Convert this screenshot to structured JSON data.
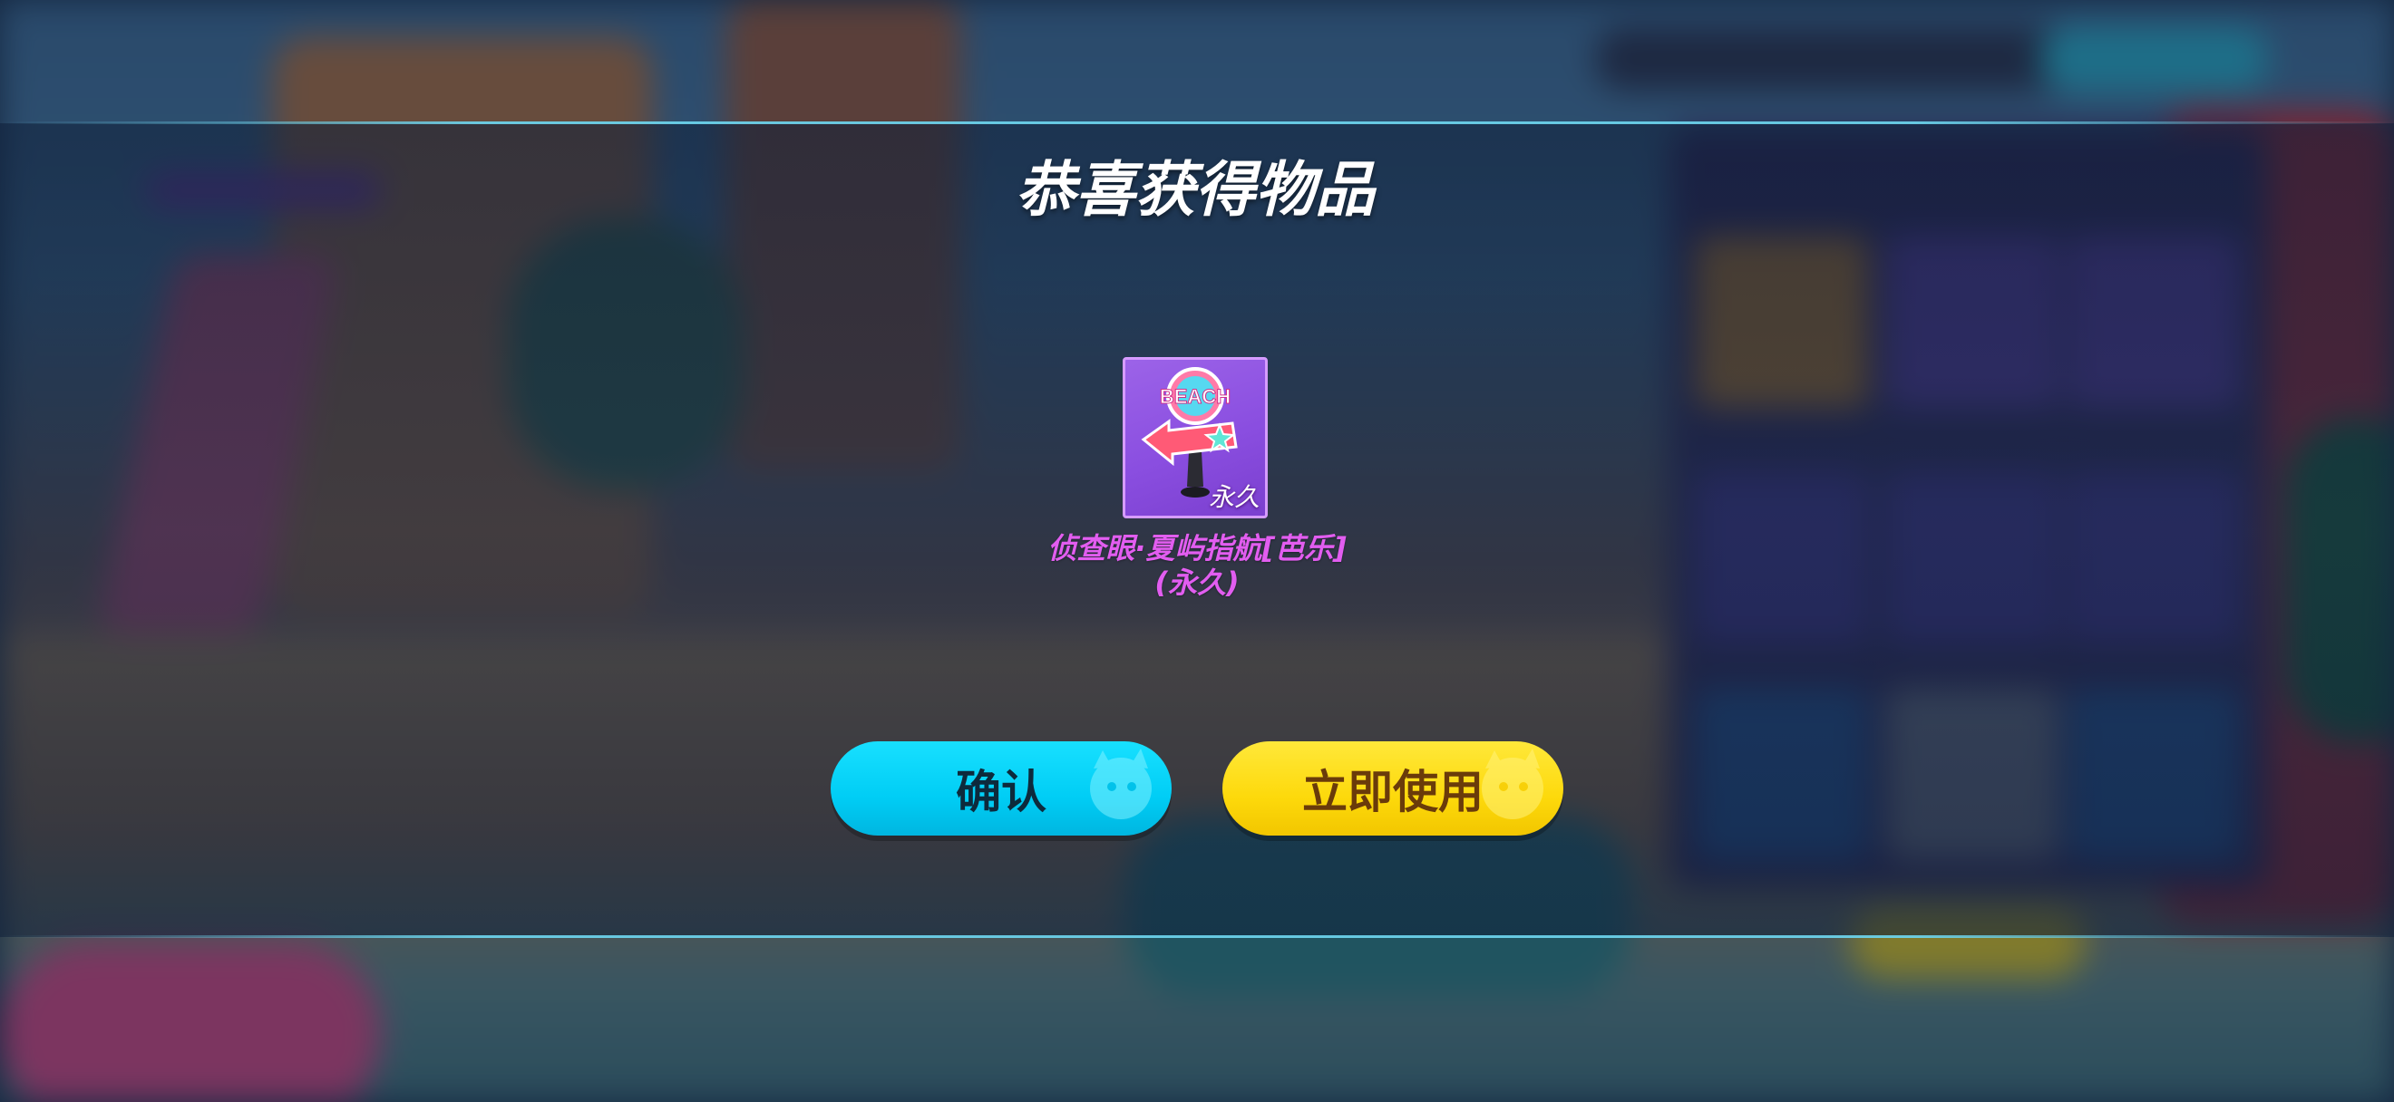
{
  "dialog": {
    "title": "恭喜获得物品",
    "item": {
      "name_line1": "侦查眼·夏屿指航[芭乐]",
      "name_line2": "(永久)",
      "duration_tag": "永久",
      "icon_text": "BEACH",
      "icon": "beach-signpost-icon"
    },
    "buttons": {
      "confirm_label": "确认",
      "use_now_label": "立即使用"
    }
  },
  "colors": {
    "item_name": "#e25df0",
    "confirm_button": "#00cdf5",
    "use_button": "#fdd90b",
    "item_card": "#8a4ee0",
    "band_line": "#6ed7f0"
  }
}
